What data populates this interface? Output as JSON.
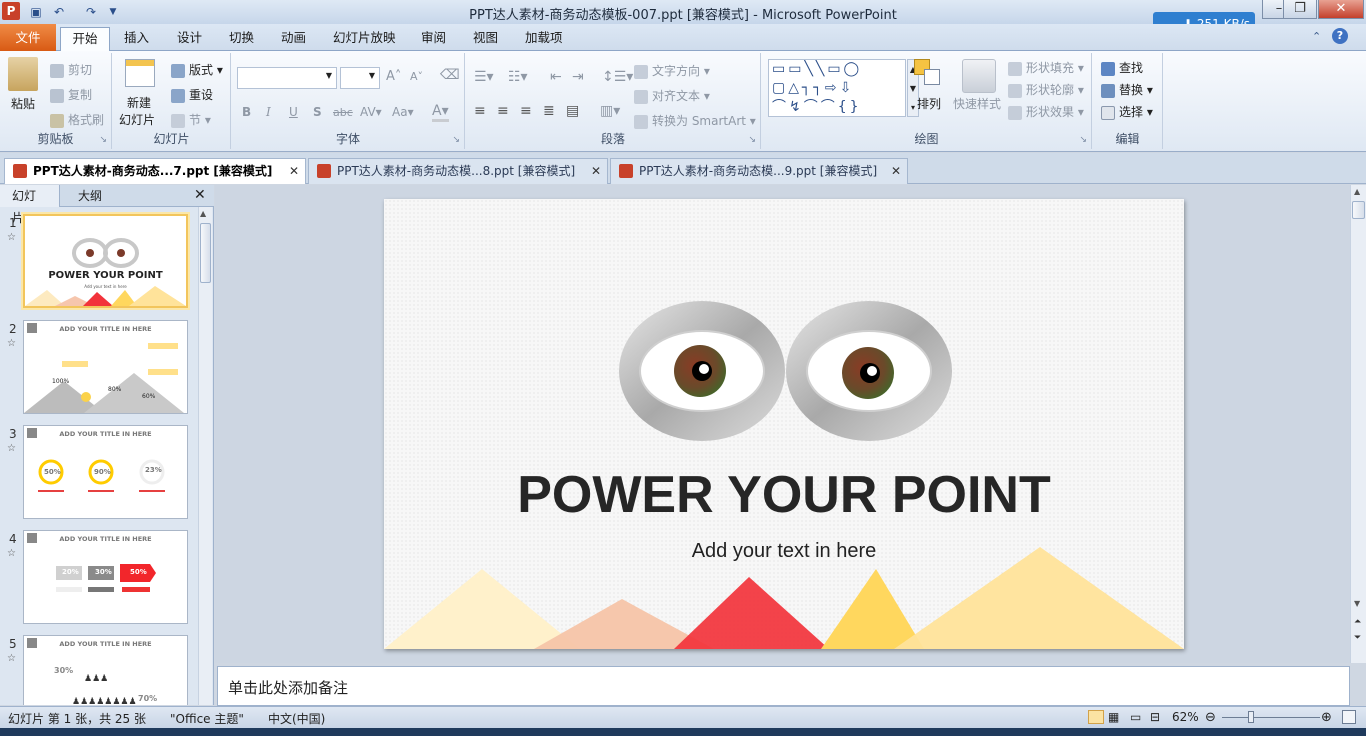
{
  "window": {
    "title": "PPT达人素材-商务动态模板-007.ppt [兼容模式]  -  Microsoft PowerPoint",
    "speed": "251 KB/s",
    "controls": {
      "minimize": "–",
      "restore": "❐",
      "close": "✕"
    }
  },
  "quick_access": {
    "save": "💾",
    "undo": "↶",
    "redo": "↷"
  },
  "menu_tabs": [
    "文件",
    "开始",
    "插入",
    "设计",
    "切换",
    "动画",
    "幻灯片放映",
    "审阅",
    "视图",
    "加载项"
  ],
  "ribbon": {
    "clipboard": {
      "label": "剪贴板",
      "paste": "粘贴",
      "cut": "剪切",
      "copy": "复制",
      "format_painter": "格式刷"
    },
    "slides": {
      "label": "幻灯片",
      "new_slide_1": "新建",
      "new_slide_2": "幻灯片",
      "layout": "版式",
      "reset": "重设",
      "section": "节"
    },
    "font": {
      "label": "字体",
      "bold": "B",
      "italic": "I",
      "underline": "U",
      "shadow": "S",
      "strike": "abc",
      "spacing": "AV",
      "case": "Aa",
      "color": "A",
      "grow": "A",
      "shrink": "A"
    },
    "paragraph": {
      "label": "段落",
      "text_direction": "文字方向",
      "align_text": "对齐文本",
      "smartart": "转换为 SmartArt"
    },
    "drawing": {
      "label": "绘图",
      "arrange": "排列",
      "quick_styles": "快速样式",
      "shape_fill": "形状填充",
      "shape_outline": "形状轮廓",
      "shape_effects": "形状效果"
    },
    "editing": {
      "label": "编辑",
      "find": "查找",
      "replace": "替换",
      "select": "选择"
    }
  },
  "doc_tabs": [
    {
      "label": "PPT达人素材-商务动态...7.ppt [兼容模式]",
      "active": true
    },
    {
      "label": "PPT达人素材-商务动态模...8.ppt [兼容模式]",
      "active": false
    },
    {
      "label": "PPT达人素材-商务动态模...9.ppt [兼容模式]",
      "active": false
    }
  ],
  "left_panel": {
    "tabs": [
      "幻灯片",
      "大纲"
    ],
    "thumbnails": [
      {
        "num": "1",
        "title": "POWER YOUR POINT",
        "sub": "Add your text in here"
      },
      {
        "num": "2",
        "title": "ADD YOUR TITLE IN HERE",
        "labels": [
          "100%",
          "80%",
          "60%"
        ]
      },
      {
        "num": "3",
        "title": "ADD YOUR TITLE IN HERE",
        "labels": [
          "50%",
          "90%",
          "23%"
        ]
      },
      {
        "num": "4",
        "title": "ADD YOUR TITLE IN HERE",
        "labels": [
          "20%",
          "30%",
          "50%"
        ]
      },
      {
        "num": "5",
        "title": "ADD YOUR TITLE IN HERE",
        "labels": [
          "30%",
          "70%"
        ]
      }
    ]
  },
  "slide": {
    "title": "POWER YOUR POINT",
    "subtitle": "Add your text in here"
  },
  "notes": {
    "placeholder": "单击此处添加备注"
  },
  "status": {
    "slide_info": "幻灯片 第 1 张，共 25 张",
    "theme": "\"Office 主题\"",
    "language": "中文(中国)",
    "zoom": "62%"
  },
  "colors": {
    "file_tab": "#d85a14",
    "accent_yellow": "#ffd75e",
    "accent_red": "#f2333b",
    "accent_peach": "#f5b89a"
  }
}
